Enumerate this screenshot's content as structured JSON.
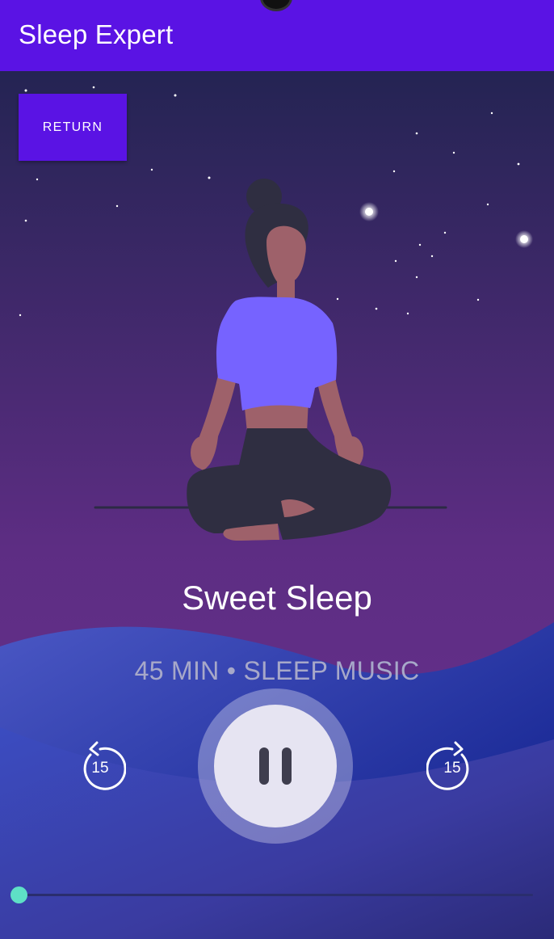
{
  "app_bar": {
    "title": "Sleep Expert"
  },
  "controls": {
    "return_label": "RETURN",
    "skip_back_seconds": "15",
    "skip_forward_seconds": "15"
  },
  "track": {
    "title": "Sweet Sleep",
    "subtitle": "45 MIN • SLEEP MUSIC",
    "state": "playing",
    "progress": 0.0
  },
  "icons": {
    "skip_back": "replay-15-icon",
    "skip_forward": "forward-15-icon",
    "pause": "pause-icon"
  },
  "colors": {
    "accent": "#5a13e4",
    "seek_thumb": "#5ee0c6",
    "shirt": "#7663ff"
  }
}
